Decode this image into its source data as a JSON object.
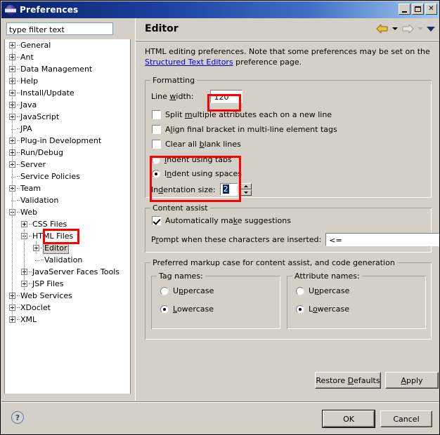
{
  "window": {
    "title": "Preferences",
    "icon": "eclipse-globe-icon",
    "buttons": {
      "minimize": "minimize-icon",
      "maximize": "maximize-icon",
      "close": "✕"
    }
  },
  "sidebar": {
    "filter": {
      "value": "type filter text",
      "placeholder": "type filter text"
    },
    "items": [
      {
        "label": "General",
        "indent": 0,
        "expander": "plus",
        "selected": false
      },
      {
        "label": "Ant",
        "indent": 0,
        "expander": "plus",
        "selected": false
      },
      {
        "label": "Data Management",
        "indent": 0,
        "expander": "plus",
        "selected": false
      },
      {
        "label": "Help",
        "indent": 0,
        "expander": "plus",
        "selected": false
      },
      {
        "label": "Install/Update",
        "indent": 0,
        "expander": "plus",
        "selected": false
      },
      {
        "label": "Java",
        "indent": 0,
        "expander": "plus",
        "selected": false
      },
      {
        "label": "JavaScript",
        "indent": 0,
        "expander": "plus",
        "selected": false
      },
      {
        "label": "JPA",
        "indent": 0,
        "expander": "none",
        "selected": false
      },
      {
        "label": "Plug-in Development",
        "indent": 0,
        "expander": "plus",
        "selected": false
      },
      {
        "label": "Run/Debug",
        "indent": 0,
        "expander": "plus",
        "selected": false
      },
      {
        "label": "Server",
        "indent": 0,
        "expander": "plus",
        "selected": false
      },
      {
        "label": "Service Policies",
        "indent": 0,
        "expander": "none",
        "selected": false
      },
      {
        "label": "Team",
        "indent": 0,
        "expander": "plus",
        "selected": false
      },
      {
        "label": "Validation",
        "indent": 0,
        "expander": "none",
        "selected": false
      },
      {
        "label": "Web",
        "indent": 0,
        "expander": "minus",
        "selected": false
      },
      {
        "label": "CSS Files",
        "indent": 1,
        "expander": "plus",
        "selected": false
      },
      {
        "label": "HTML Files",
        "indent": 1,
        "expander": "minus",
        "selected": false
      },
      {
        "label": "Editor",
        "indent": 2,
        "expander": "plus",
        "selected": true
      },
      {
        "label": "Validation",
        "indent": 2,
        "expander": "none",
        "selected": false
      },
      {
        "label": "JavaServer Faces Tools",
        "indent": 1,
        "expander": "plus",
        "selected": false
      },
      {
        "label": "JSP Files",
        "indent": 1,
        "expander": "plus",
        "selected": false
      },
      {
        "label": "Web Services",
        "indent": 0,
        "expander": "plus",
        "selected": false
      },
      {
        "label": "XDoclet",
        "indent": 0,
        "expander": "plus",
        "selected": false
      },
      {
        "label": "XML",
        "indent": 0,
        "expander": "plus",
        "selected": false
      }
    ]
  },
  "page": {
    "title": "Editor",
    "nav": {
      "back_icon": "back-arrow-icon",
      "back_menu_icon": "chevron-down-icon",
      "forward_icon": "forward-arrow-icon",
      "forward_menu_icon": "chevron-down-icon",
      "menu_icon": "chevron-down-icon"
    },
    "description_part1": "HTML editing preferences.  Note that some preferences may be set on the ",
    "description_link": "Structured Text Editors",
    "description_part2": " preference page."
  },
  "formatting": {
    "title": "Formatting",
    "line_width_label": "Line width:",
    "line_width_value": "120",
    "checkboxes": [
      {
        "label_pre": "Split ",
        "label_underline": "m",
        "label_post": "ultiple attributes each on a new line",
        "checked": false
      },
      {
        "label_pre": "A",
        "label_underline": "l",
        "label_post": "ign final bracket in multi-line element tags",
        "checked": false
      },
      {
        "label_pre": "Clear all ",
        "label_underline": "b",
        "label_post": "lank lines",
        "checked": false
      }
    ],
    "radios": [
      {
        "label_pre": "",
        "label_underline": "I",
        "label_post": "ndent using tabs",
        "checked": false
      },
      {
        "label_pre": "I",
        "label_underline": "n",
        "label_post": "dent using spaces",
        "checked": true
      }
    ],
    "indentation_label": "Indentation size:",
    "indentation_value": "2"
  },
  "content_assist": {
    "title": "Content assist",
    "auto_suggest": {
      "label_pre": "Automatically ma",
      "label_underline": "k",
      "label_post": "e suggestions",
      "checked": true
    },
    "prompt_label_pre": "P",
    "prompt_label_underline": "r",
    "prompt_label_post": "ompt when these characters are inserted:",
    "prompt_value": "<="
  },
  "markup_case": {
    "title": "Preferred markup case for content assist, and code generation",
    "tag_names": {
      "title": "Tag names:",
      "options": [
        {
          "label_pre": "U",
          "label_underline": "p",
          "label_post": "percase",
          "checked": false
        },
        {
          "label_pre": "",
          "label_underline": "L",
          "label_post": "owercase",
          "checked": true
        }
      ]
    },
    "attribute_names": {
      "title": "Attribute names:",
      "options": [
        {
          "label_pre": "U",
          "label_underline": "p",
          "label_post": "percase",
          "checked": false
        },
        {
          "label_pre": "L",
          "label_underline": "o",
          "label_post": "wercase",
          "checked": true
        }
      ]
    }
  },
  "buttons": {
    "restore_defaults_pre": "Restore ",
    "restore_defaults_underline": "D",
    "restore_defaults_post": "efaults",
    "apply_pre": "",
    "apply_underline": "A",
    "apply_post": "pply",
    "ok": "OK",
    "cancel": "Cancel",
    "help_icon": "?"
  },
  "colors": {
    "titlebar_start": "#0a246a",
    "titlebar_end": "#a6caf0",
    "dialog_bg": "#d4d0c8",
    "annotation_red": "#ff0000",
    "link_blue": "#0000cc",
    "selection_blue": "#0a246a"
  }
}
